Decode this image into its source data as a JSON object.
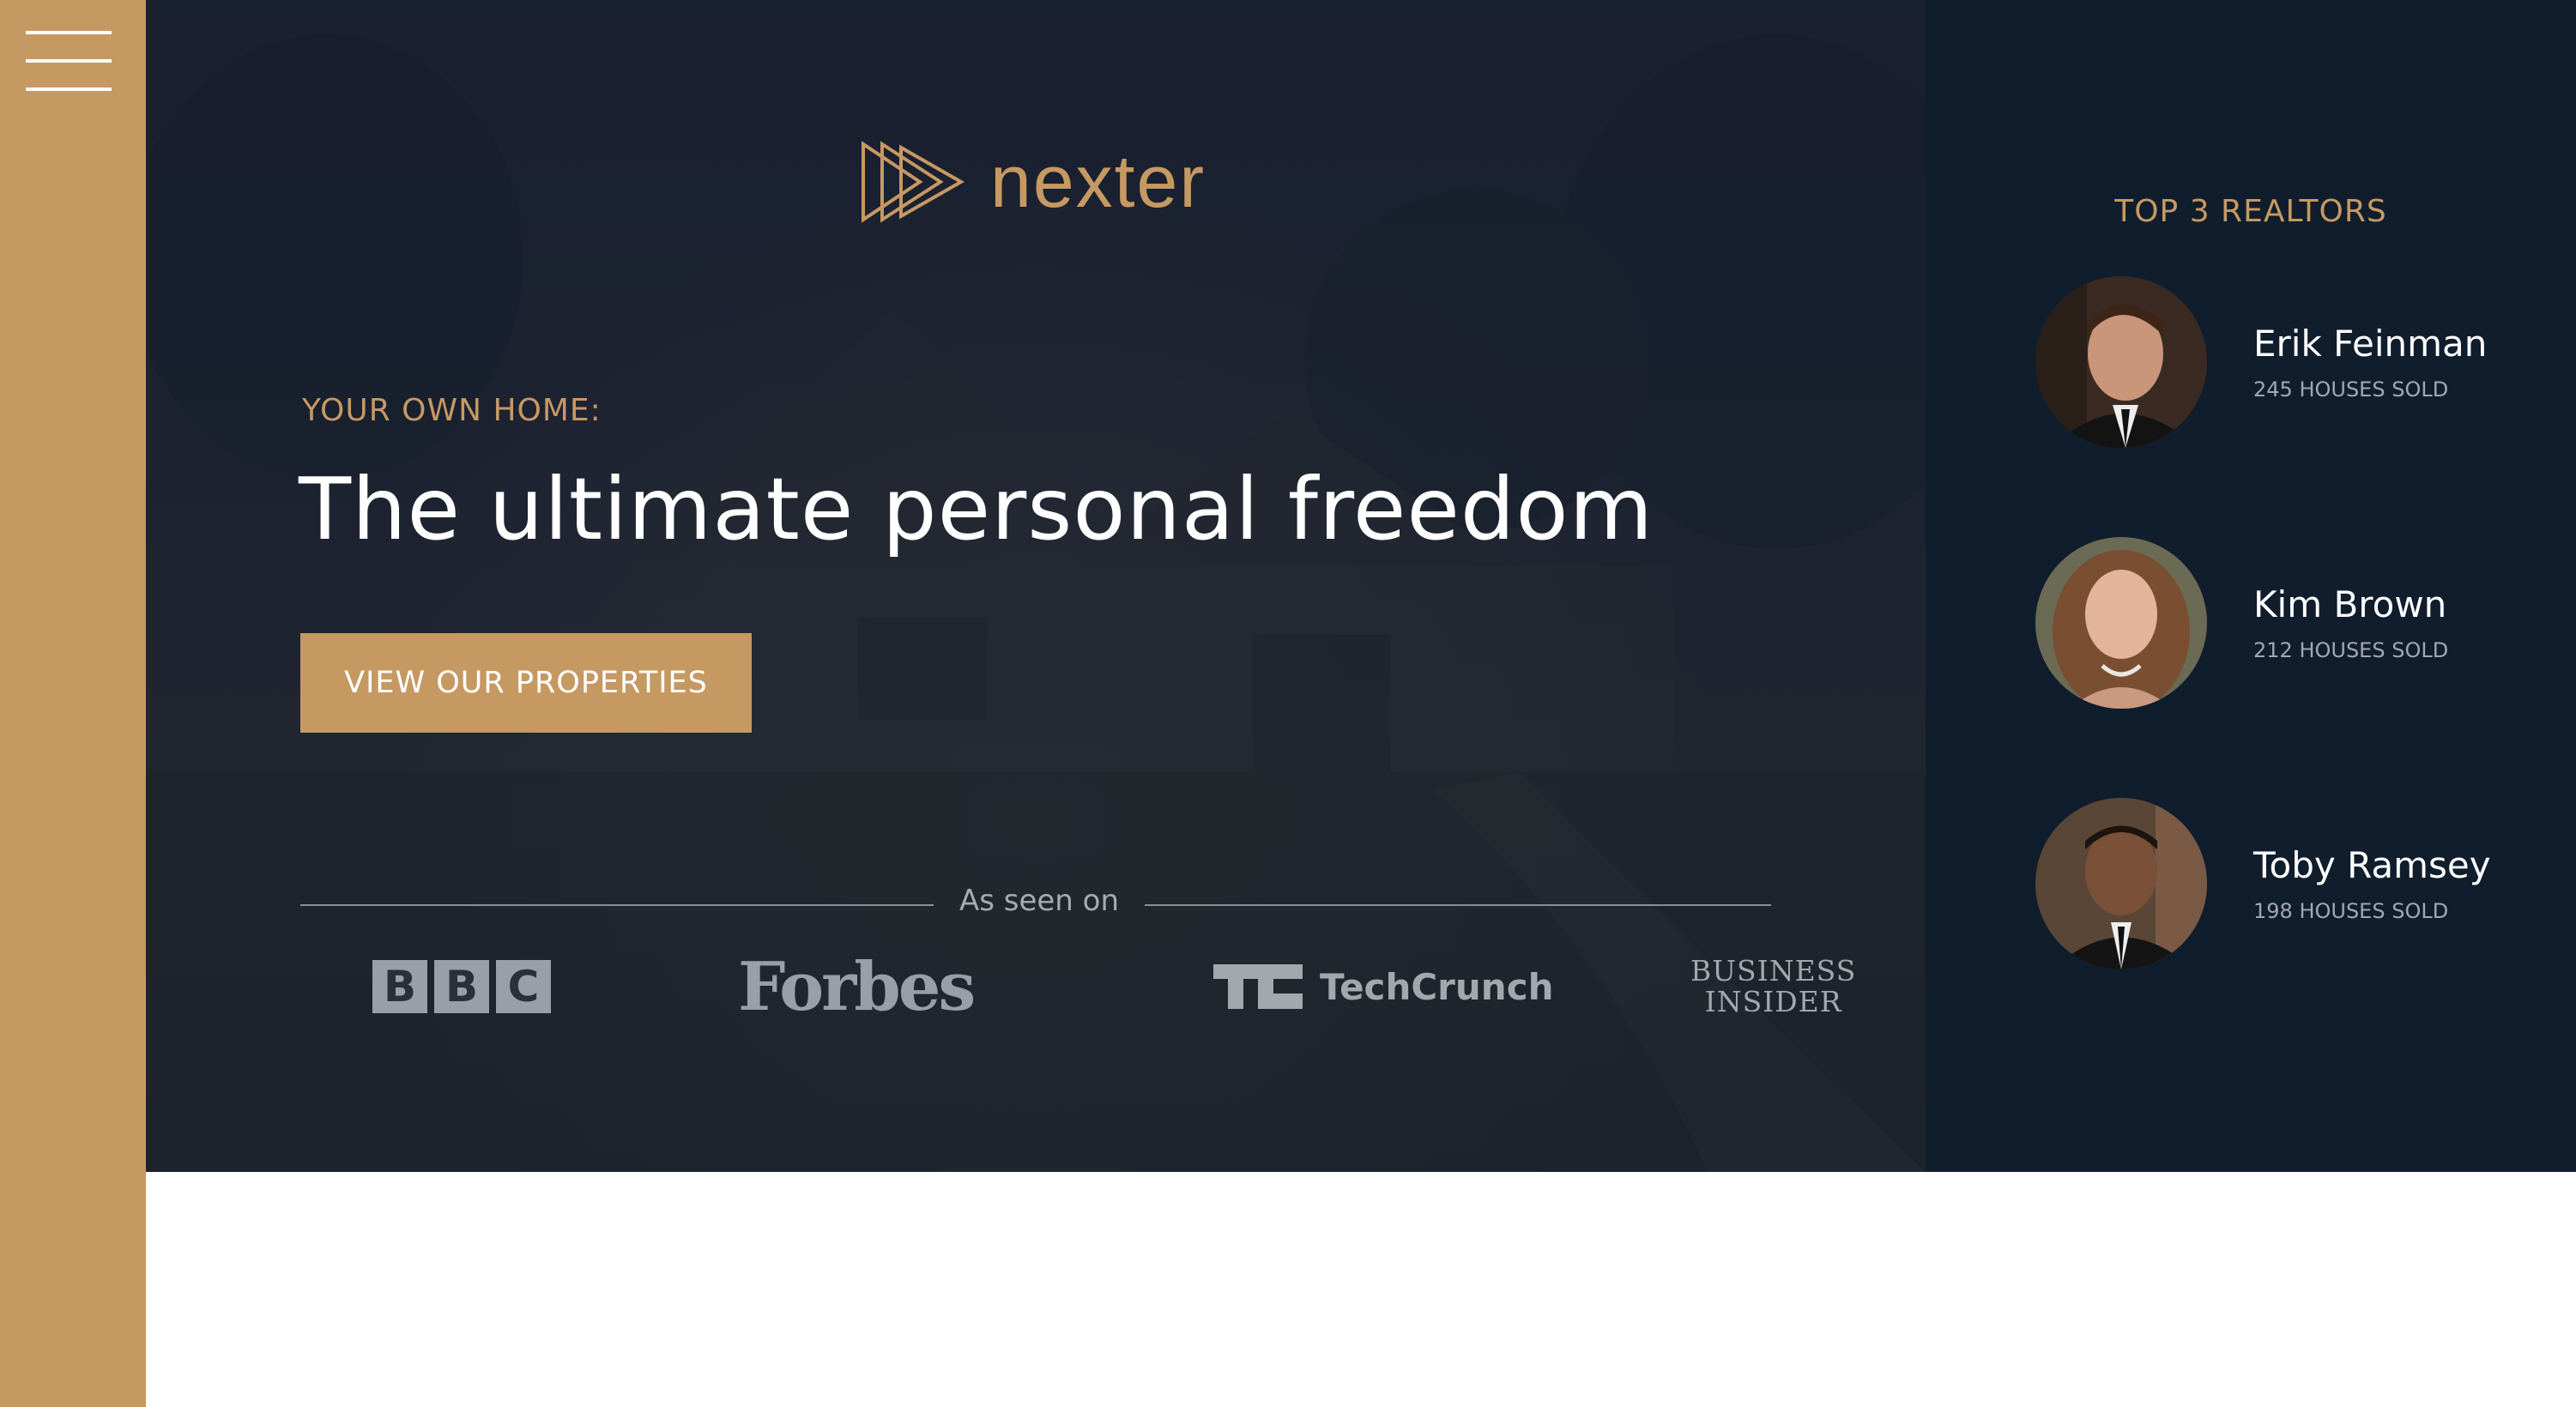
{
  "sidebar": {
    "menu_icon": "hamburger-menu-icon",
    "background_color": "#c69963"
  },
  "header": {
    "logo_text": "nexter",
    "logo_icon": "triple-play-triangle-icon",
    "eyebrow": "YOUR OWN HOME:",
    "headline": "The ultimate personal freedom",
    "cta_label": "VIEW OUR PROPERTIES",
    "seen_on_label": "As seen on",
    "press_logos": {
      "bbc": [
        "B",
        "B",
        "C"
      ],
      "forbes": "Forbes",
      "techcrunch": "TechCrunch",
      "business_insider_line1": "BUSINESS",
      "business_insider_line2": "INSIDER"
    }
  },
  "realtors": {
    "title": "TOP 3 REALTORS",
    "items": [
      {
        "name": "Erik Feinman",
        "sold": "245 HOUSES SOLD"
      },
      {
        "name": "Kim Brown",
        "sold": "212 HOUSES SOLD"
      },
      {
        "name": "Toby Ramsey",
        "sold": "198 HOUSES SOLD"
      }
    ]
  },
  "colors": {
    "accent": "#c69963",
    "dark": "#101d2c",
    "white": "#ffffff"
  }
}
